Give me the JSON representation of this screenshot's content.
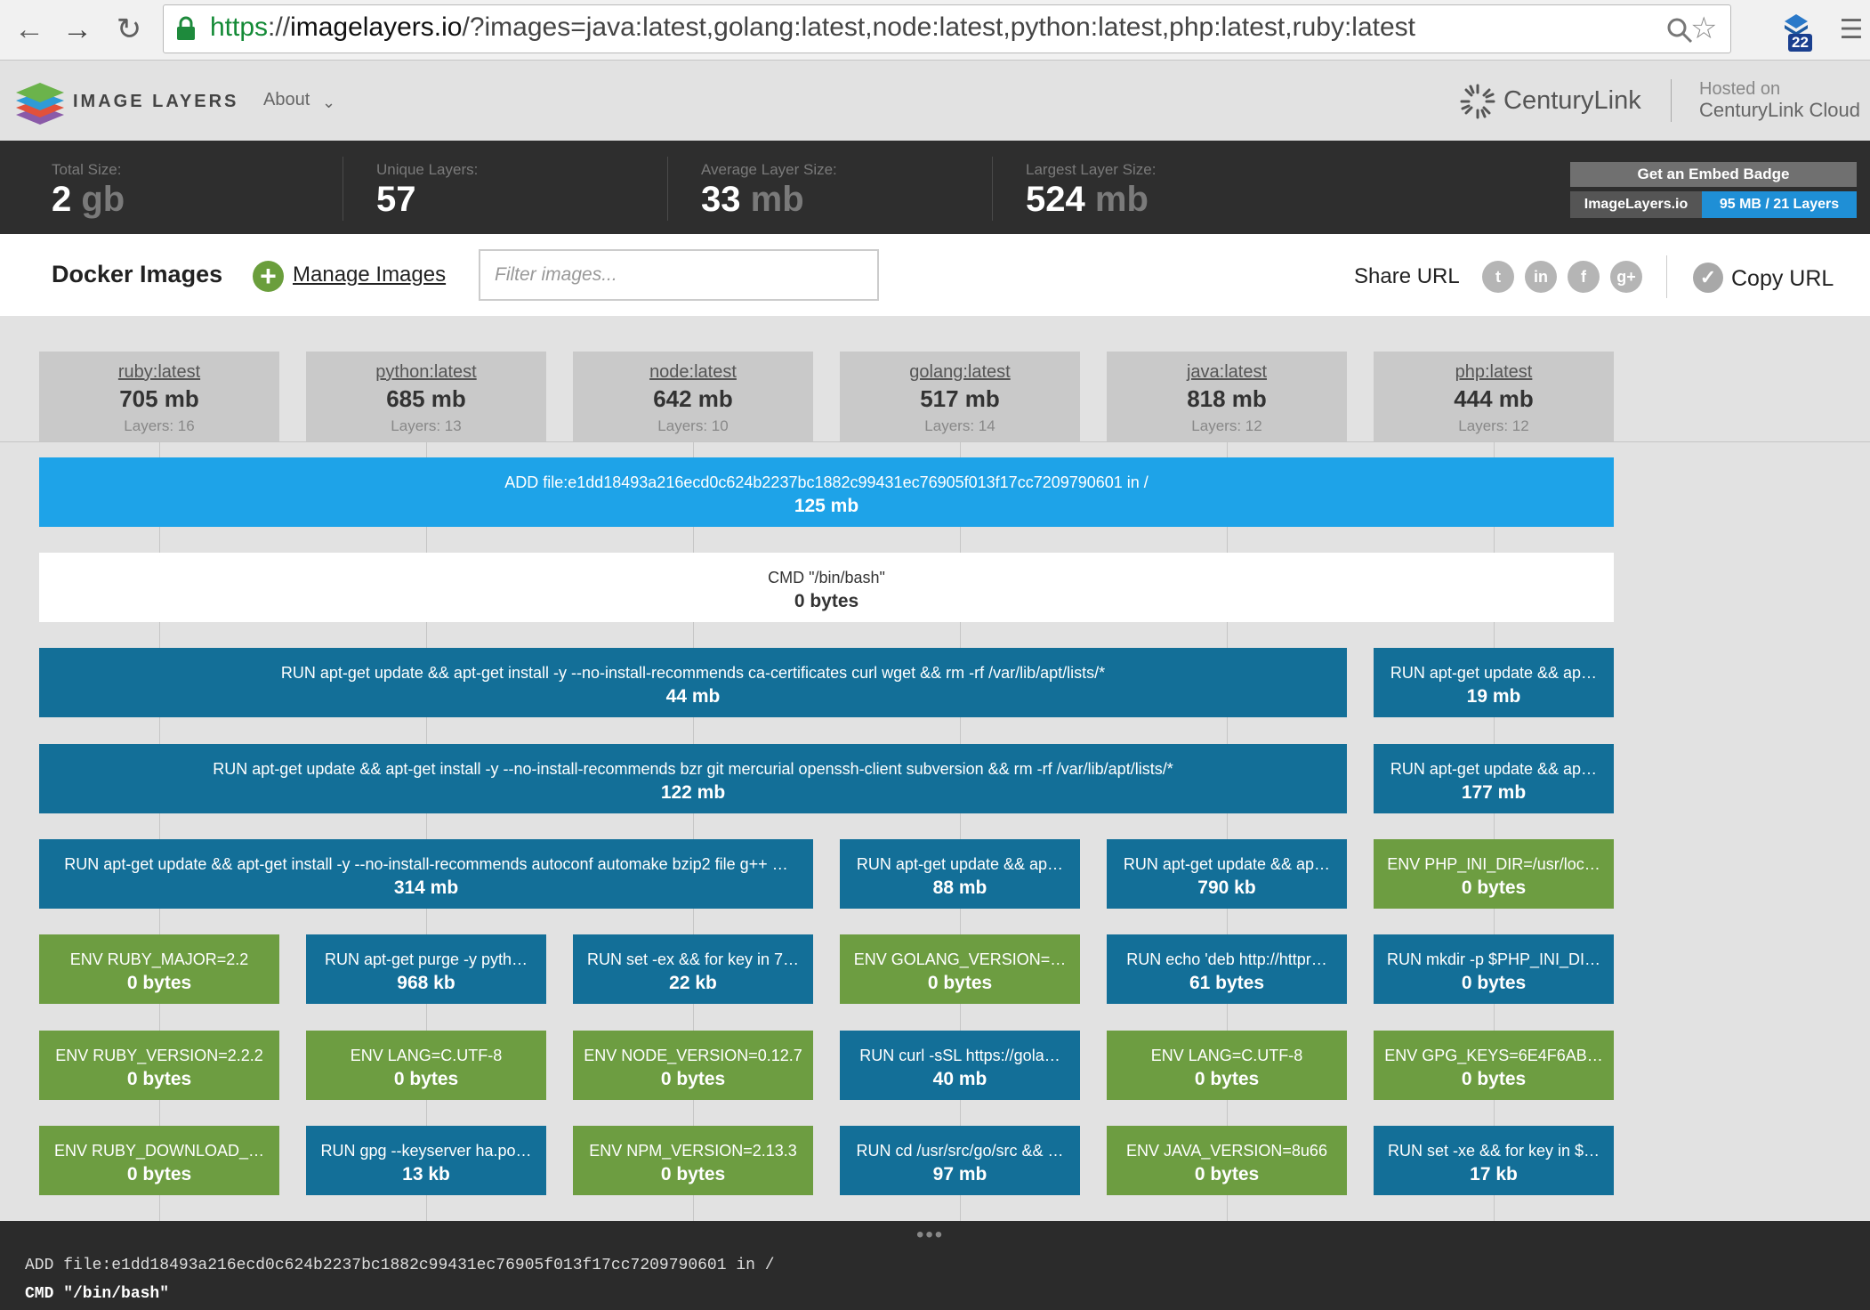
{
  "browser": {
    "url_scheme": "https",
    "url_sep": "://",
    "url_host": "imagelayers.io",
    "url_rest": "/?images=java:latest,golang:latest,node:latest,python:latest,php:latest,ruby:latest",
    "extension_badge": "22"
  },
  "header": {
    "brand": "IMAGE LAYERS",
    "about": "About",
    "centurylink": "CenturyLink",
    "hosted_line1": "Hosted on",
    "hosted_line2": "CenturyLink Cloud"
  },
  "stats": {
    "total_label": "Total Size:",
    "total_value": "2",
    "total_unit": "gb",
    "unique_label": "Unique Layers:",
    "unique_value": "57",
    "avg_label": "Average Layer Size:",
    "avg_value": "33",
    "avg_unit": "mb",
    "largest_label": "Largest Layer Size:",
    "largest_value": "524",
    "largest_unit": "mb",
    "embed_button": "Get an Embed Badge",
    "badge_left": "ImageLayers.io",
    "badge_right": "95 MB / 21 Layers"
  },
  "toolbar": {
    "title": "Docker Images",
    "manage": "Manage Images",
    "filter_placeholder": "Filter images...",
    "share_label": "Share URL",
    "copy_label": "Copy URL"
  },
  "images": [
    {
      "name": "ruby:latest",
      "size": "705 mb",
      "layers": "Layers: 16"
    },
    {
      "name": "python:latest",
      "size": "685 mb",
      "layers": "Layers: 13"
    },
    {
      "name": "node:latest",
      "size": "642 mb",
      "layers": "Layers: 10"
    },
    {
      "name": "golang:latest",
      "size": "517 mb",
      "layers": "Layers: 14"
    },
    {
      "name": "java:latest",
      "size": "818 mb",
      "layers": "Layers: 12"
    },
    {
      "name": "php:latest",
      "size": "444 mb",
      "layers": "Layers: 12"
    }
  ],
  "layers": {
    "row1": {
      "cmd": "ADD file:e1dd18493a216ecd0c624b2237bc1882c99431ec76905f013f17cc7209790601 in /",
      "size": "125 mb"
    },
    "row2": {
      "cmd": "CMD \"/bin/bash\"",
      "size": "0 bytes"
    },
    "row3a": {
      "cmd": "RUN apt-get update && apt-get install -y --no-install-recommends ca-certificates curl wget && rm -rf /var/lib/apt/lists/*",
      "size": "44 mb"
    },
    "row3b": {
      "cmd": "RUN apt-get update && ap…",
      "size": "19 mb"
    },
    "row4a": {
      "cmd": "RUN apt-get update && apt-get install -y --no-install-recommends bzr git mercurial openssh-client subversion && rm -rf /var/lib/apt/lists/*",
      "size": "122 mb"
    },
    "row4b": {
      "cmd": "RUN apt-get update && ap…",
      "size": "177 mb"
    },
    "row5a": {
      "cmd": "RUN apt-get update && apt-get install -y --no-install-recommends autoconf automake bzip2 file g++ …",
      "size": "314 mb"
    },
    "row5b": {
      "cmd": "RUN apt-get update && ap…",
      "size": "88 mb"
    },
    "row5c": {
      "cmd": "RUN apt-get update && ap…",
      "size": "790 kb"
    },
    "row5d": {
      "cmd": "ENV PHP_INI_DIR=/usr/loc…",
      "size": "0 bytes"
    },
    "row6": [
      {
        "cmd": "ENV RUBY_MAJOR=2.2",
        "size": "0 bytes"
      },
      {
        "cmd": "RUN apt-get purge -y pyth…",
        "size": "968 kb"
      },
      {
        "cmd": "RUN set -ex && for key in 7…",
        "size": "22 kb"
      },
      {
        "cmd": "ENV GOLANG_VERSION=…",
        "size": "0 bytes"
      },
      {
        "cmd": "RUN echo 'deb http://httpr…",
        "size": "61 bytes"
      },
      {
        "cmd": "RUN mkdir -p $PHP_INI_DI…",
        "size": "0 bytes"
      }
    ],
    "row7": [
      {
        "cmd": "ENV RUBY_VERSION=2.2.2",
        "size": "0 bytes"
      },
      {
        "cmd": "ENV LANG=C.UTF-8",
        "size": "0 bytes"
      },
      {
        "cmd": "ENV NODE_VERSION=0.12.7",
        "size": "0 bytes"
      },
      {
        "cmd": "RUN curl -sSL https://gola…",
        "size": "40 mb"
      },
      {
        "cmd": "ENV LANG=C.UTF-8",
        "size": "0 bytes"
      },
      {
        "cmd": "ENV GPG_KEYS=6E4F6AB…",
        "size": "0 bytes"
      }
    ],
    "row8": [
      {
        "cmd": "ENV RUBY_DOWNLOAD_…",
        "size": "0 bytes"
      },
      {
        "cmd": "RUN gpg --keyserver ha.po…",
        "size": "13 kb"
      },
      {
        "cmd": "ENV NPM_VERSION=2.13.3",
        "size": "0 bytes"
      },
      {
        "cmd": "RUN cd /usr/src/go/src && …",
        "size": "97 mb"
      },
      {
        "cmd": "ENV JAVA_VERSION=8u66",
        "size": "0 bytes"
      },
      {
        "cmd": "RUN set -xe && for key in $…",
        "size": "17 kb"
      }
    ]
  },
  "bottom": {
    "dots": "•••",
    "line1_kw": "ADD",
    "line1_rest": " file:e1dd18493a216ecd0c624b2237bc1882c99431ec76905f013f17cc7209790601 in /",
    "line2_kw": "CMD",
    "line2_rest": " \"/bin/bash\""
  },
  "colors": {
    "base_layer": "#1ea3e8",
    "run_layer": "#136f98",
    "env_layer": "#6d9d41",
    "stats_bg": "#2e2e2e"
  }
}
